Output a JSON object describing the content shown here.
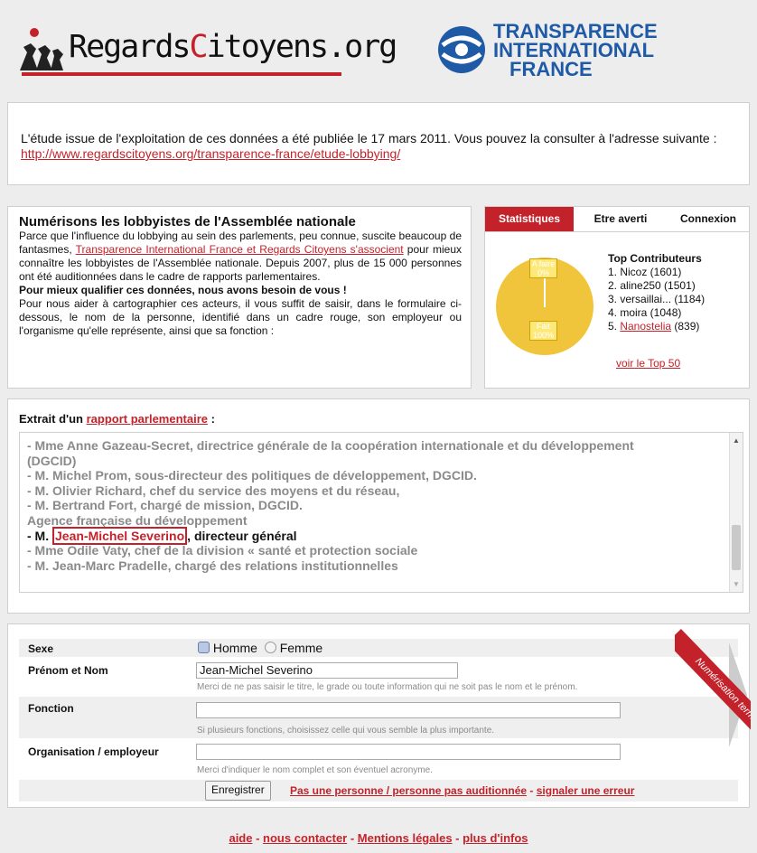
{
  "header": {
    "rc_logo_text_a": "Regards",
    "rc_logo_text_b": "C",
    "rc_logo_text_c": "itoyens.org",
    "ti_logo_line1": "TRANSPARENCE",
    "ti_logo_line2": "INTERNATIONAL",
    "ti_logo_line3": "FRANCE",
    "colors": {
      "accent": "#c4222a",
      "ti_blue": "#1f5aa6"
    }
  },
  "publication": {
    "text": "L'étude issue de l'exploitation de ces données a été publiée le 17 mars 2011. Vous pouvez la consulter à l'adresse suivante : ",
    "link": "http://www.regardscitoyens.org/transparence-france/etude-lobbying/"
  },
  "intro": {
    "title": "Numérisons les lobbyistes de l'Assemblée nationale",
    "p1_a": "Parce que l'influence du lobbying au sein des parlements, peu connue, suscite beaucoup de fantasmes, ",
    "p1_link": "Transparence International France et Regards Citoyens s'associent",
    "p1_b": " pour mieux connaître les lobbyistes de l'Assemblée nationale. Depuis 2007, plus de 15 000 personnes ont été auditionnées dans le cadre de rapports parlementaires.",
    "p2_bold": "Pour mieux qualifier ces données, nous avons besoin de vous !",
    "p3": "Pour nous aider à cartographier ces acteurs, il vous suffit de saisir, dans le formulaire ci-dessous, le nom de la personne, identifié dans un cadre rouge, son employeur ou l'organisme qu'elle représente, ainsi que sa fonction :"
  },
  "stats": {
    "tabs": [
      "Statistiques",
      "Etre averti",
      "Connexion"
    ],
    "pie": {
      "a_faire_label": "A faire",
      "a_faire_value": "0%",
      "fait_label": "Fait",
      "fait_value": "100%",
      "fait_fraction": 1.0
    },
    "top_title": "Top Contributeurs",
    "contributors": [
      "1. Nicoz (1601)",
      "2. aline250 (1501)",
      "3. versaillai... (1184)",
      "4. moira (1048)"
    ],
    "c5_prefix": "5. ",
    "c5_link": "Nanostelia",
    "c5_suffix": " (839)",
    "top50_link": "voir le Top 50"
  },
  "extract": {
    "title_prefix": "Extrait d'un ",
    "title_link": "rapport parlementaire",
    "title_suffix": " :",
    "lines": [
      "- Mme Anne Gazeau-Secret, directrice générale de la coopération internationale et du développement",
      "(DGCID)",
      "- M. Michel Prom, sous-directeur des politiques de développement, DGCID.",
      "- M. Olivier Richard, chef du service des moyens et du réseau,",
      "- M. Bertrand Fort, chargé de mission, DGCID.",
      "Agence française du développement"
    ],
    "hl_prefix": "- M. ",
    "hl_name": "Jean-Michel Severino",
    "hl_suffix": ", directeur général",
    "after_lines": [
      "- Mme Odile Vaty, chef de la division « santé et protection sociale",
      "- M. Jean-Marc Pradelle, chargé des relations institutionnelles"
    ]
  },
  "form": {
    "sexe_label": "Sexe",
    "homme": "Homme",
    "femme": "Femme",
    "nom_label": "Prénom et Nom",
    "nom_value": "Jean-Michel Severino",
    "nom_help": "Merci de ne pas saisir le titre, le grade ou toute information qui ne soit pas le nom et le prénom.",
    "fonction_label": "Fonction",
    "fonction_value": "",
    "fonction_help": "Si plusieurs fonctions, choisissez celle qui vous semble la plus importante.",
    "org_label": "Organisation / employeur",
    "org_value": "",
    "org_help": "Merci d'indiquer le nom complet et son éventuel acronyme.",
    "submit": "Enregistrer",
    "link_notperson": "Pas une personne / personne pas auditionnée",
    "sep": " - ",
    "link_error": "signaler une erreur",
    "ribbon": "Numérisation terminée !"
  },
  "footer": {
    "aide": "aide",
    "contact": "nous contacter",
    "mentions": "Mentions légales",
    "infos": "plus d'infos",
    "sep": " - "
  }
}
